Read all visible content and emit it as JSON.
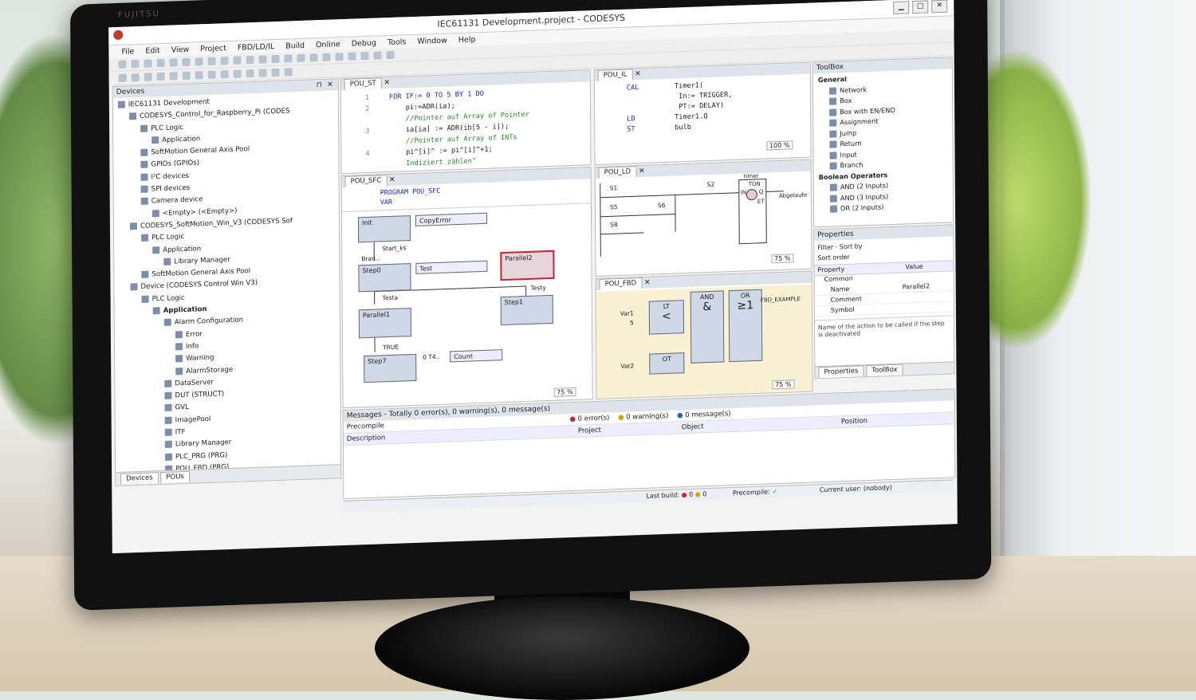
{
  "window": {
    "title": "IEC61131 Development.project - CODESYS",
    "min": "▁",
    "max": "□",
    "close": "✕",
    "bezel_brand": "FUJITSU"
  },
  "menu": [
    "File",
    "Edit",
    "View",
    "Project",
    "FBD/LD/IL",
    "Build",
    "Online",
    "Debug",
    "Tools",
    "Window",
    "Help"
  ],
  "devices": {
    "title": "Devices",
    "items": [
      {
        "label": "IEC61131 Development",
        "indent": 0
      },
      {
        "label": "CODESYS_Control_for_Raspberry_Pi (CODES",
        "indent": 1
      },
      {
        "label": "PLC Logic",
        "indent": 2
      },
      {
        "label": "Application",
        "indent": 3
      },
      {
        "label": "SoftMotion General Axis Pool",
        "indent": 2
      },
      {
        "label": "GPIOs (GPIOs)",
        "indent": 2
      },
      {
        "label": "I²C devices",
        "indent": 2
      },
      {
        "label": "SPI devices",
        "indent": 2
      },
      {
        "label": "Camera device",
        "indent": 2
      },
      {
        "label": "<Empty> (<Empty>)",
        "indent": 3
      },
      {
        "label": "CODESYS_SoftMotion_Win_V3 (CODESYS Sof",
        "indent": 1
      },
      {
        "label": "PLC Logic",
        "indent": 2
      },
      {
        "label": "Application",
        "indent": 3
      },
      {
        "label": "Library Manager",
        "indent": 4
      },
      {
        "label": "SoftMotion General Axis Pool",
        "indent": 2
      },
      {
        "label": "Device (CODESYS Control Win V3)",
        "indent": 1
      },
      {
        "label": "PLC Logic",
        "indent": 2
      },
      {
        "label": "Application",
        "indent": 3,
        "bold": true
      },
      {
        "label": "Alarm Configuration",
        "indent": 4
      },
      {
        "label": "Error",
        "indent": 5
      },
      {
        "label": "Info",
        "indent": 5
      },
      {
        "label": "Warning",
        "indent": 5
      },
      {
        "label": "AlarmStorage",
        "indent": 5
      },
      {
        "label": "DataServer",
        "indent": 4
      },
      {
        "label": "DUT (STRUCT)",
        "indent": 4
      },
      {
        "label": "GVL",
        "indent": 4
      },
      {
        "label": "ImagePool",
        "indent": 4
      },
      {
        "label": "ITF",
        "indent": 4
      },
      {
        "label": "Library Manager",
        "indent": 4
      },
      {
        "label": "PLC_PRG (PRG)",
        "indent": 4
      },
      {
        "label": "POU_FBD (PRG)",
        "indent": 4
      }
    ],
    "bottom_tabs": [
      "Devices",
      "POUs"
    ]
  },
  "pou_st": {
    "tab": "POU_ST",
    "lines": [
      {
        "n": "1",
        "t": "FOR IF:= 0 TO 5 BY 1 DO",
        "cls": "kw"
      },
      {
        "n": "2",
        "t": "    pi:=ADR(ia);",
        "cls": ""
      },
      {
        "n": "",
        "t": "    //Pointer auf Array of Pointer",
        "cls": "cm"
      },
      {
        "n": "3",
        "t": "    ia[ia] := ADR(ib[5 - i]);",
        "cls": ""
      },
      {
        "n": "",
        "t": "    //Pointer auf Array of INTs",
        "cls": "cm"
      },
      {
        "n": "4",
        "t": "    pi^[i]^ := pi^[i]^+1;",
        "cls": ""
      },
      {
        "n": "",
        "t": "    Indiziert zählen\"",
        "cls": "cm"
      }
    ]
  },
  "pou_il": {
    "tab": "POU_IL",
    "lines": [
      {
        "op": "CAL",
        "arg": "Timer1("
      },
      {
        "op": "",
        "arg": "  In:= TRIGGER,"
      },
      {
        "op": "",
        "arg": "  PT:= DELAY)"
      },
      {
        "op": "LD",
        "arg": "Timer1.Q"
      },
      {
        "op": "ST",
        "arg": "bulb"
      }
    ],
    "zoom": "100 %"
  },
  "pou_sfc": {
    "tab": "POU_SFC",
    "decl": [
      "PROGRAM POU_SFC",
      "VAR"
    ],
    "steps": [
      "Init",
      "Step0",
      "Parallel1",
      "Step7",
      "Parallel2",
      "Step1"
    ],
    "actions": [
      "CopyError",
      "Test",
      "Count"
    ],
    "transitions": [
      "Start_ks",
      "Testa",
      "Testy"
    ],
    "labels": [
      "Bran..",
      "0 T4..",
      "TRUE"
    ],
    "zoom": "75 %"
  },
  "pou_ld": {
    "tab": "POU_LD",
    "contacts": [
      "S1",
      "S2",
      "S5",
      "S6",
      "S8"
    ],
    "timer": {
      "name": "timer",
      "type": "TON",
      "in": "IN",
      "q": "Q",
      "et": "ET"
    },
    "coil": "Abgelaufe",
    "zoom": "75 %"
  },
  "pou_fbd": {
    "tab": "POU_FBD",
    "blocks": [
      {
        "head": "LT",
        "sym": "<"
      },
      {
        "head": "AND",
        "sym": "&"
      },
      {
        "head": "OR",
        "sym": "≥1"
      },
      {
        "head": "OT",
        "sym": ""
      }
    ],
    "inputs": [
      "Var1",
      "5",
      "Var2"
    ],
    "output": "FBD_EXAMPLE",
    "zoom": "75 %"
  },
  "toolbox": {
    "title": "ToolBox",
    "general_label": "General",
    "general": [
      "Network",
      "Box",
      "Box with EN/ENO",
      "Assignment",
      "Jump",
      "Return",
      "Input",
      "Branch"
    ],
    "bool_label": "Boolean Operators",
    "bool": [
      "AND (2 Inputs)",
      "AND (3 Inputs)",
      "OR (2 Inputs)"
    ]
  },
  "properties": {
    "title": "Properties",
    "filter": "Filter",
    "sort_by": "Sort by",
    "sort_order": "Sort order",
    "col_property": "Property",
    "col_value": "Value",
    "group": "Common",
    "rows": [
      {
        "k": "Name",
        "v": "Parallel2"
      },
      {
        "k": "Comment",
        "v": ""
      },
      {
        "k": "Symbol",
        "v": ""
      }
    ],
    "hint": "Name of the action to be called if the step is deactivated",
    "tabs": [
      "Properties",
      "ToolBox"
    ]
  },
  "messages": {
    "title": "Messages - Totally 0 error(s), 0 warning(s), 0 message(s)",
    "errors": "0 error(s)",
    "warnings": "0 warning(s)",
    "messages": "0 message(s)",
    "filter": "Precompile",
    "cols": [
      "Description",
      "Project",
      "Object",
      "Position"
    ]
  },
  "status": {
    "last_build": "Last build:",
    "err_count": "0",
    "warn_count": "0",
    "precompile": "Precompile:",
    "precompile_ok": "✓",
    "user": "Current user: (nobody)"
  }
}
